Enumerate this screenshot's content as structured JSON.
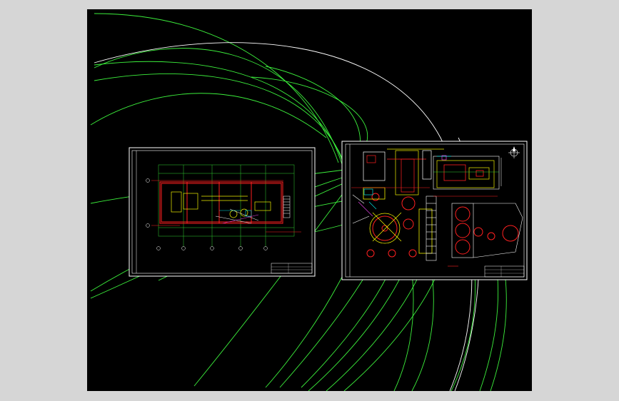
{
  "viewer": {
    "background_color": "#d6d6d6",
    "canvas_color": "#000000"
  },
  "drawing": {
    "line_colors": {
      "arc_green": "#3cf03c",
      "arc_white": "#ffffff",
      "frame": "#ffffff",
      "wall_red": "#ff2020",
      "equipment_yellow": "#f0f000",
      "grid_green": "#30d030",
      "accent_cyan": "#00e0e0",
      "accent_magenta": "#e040e0"
    },
    "sheets": [
      {
        "name": "sheet-left",
        "content": "plan-view-long-building"
      },
      {
        "name": "sheet-right",
        "content": "equipment-layout-plan"
      }
    ],
    "north_arrow_icon": "north-arrow-icon"
  }
}
